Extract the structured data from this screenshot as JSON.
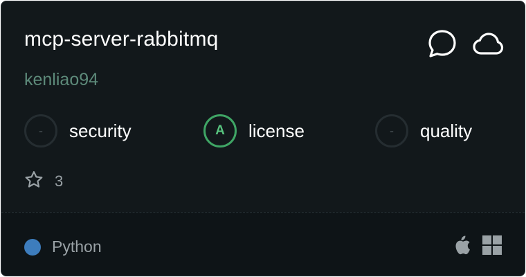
{
  "card": {
    "title": "mcp-server-rabbitmq",
    "author": "kenliao94",
    "top_icons": [
      "chat-bubble-icon",
      "cloud-icon"
    ],
    "scores": [
      {
        "label": "security",
        "grade": "-",
        "status": "none"
      },
      {
        "label": "license",
        "grade": "A",
        "status": "grade-a"
      },
      {
        "label": "quality",
        "grade": "-",
        "status": "none"
      }
    ],
    "stars": {
      "icon": "star-icon",
      "count": "3"
    },
    "footer": {
      "language": "Python",
      "language_color": "#3d7dbd",
      "platforms": [
        "apple-icon",
        "windows-icon"
      ]
    }
  },
  "colors": {
    "background": "#12181b",
    "author": "#5d8a7a",
    "grade_a": "#3fa565"
  }
}
